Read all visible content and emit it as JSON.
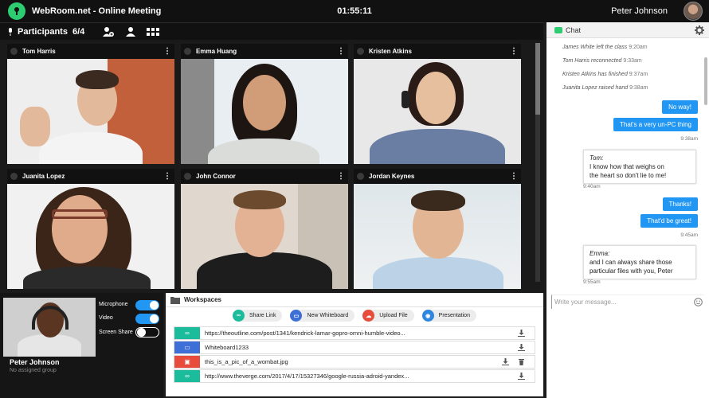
{
  "app": {
    "title": "WebRoom.net  -  Online Meeting",
    "clock": "01:55:11",
    "user": "Peter Johnson"
  },
  "participants": {
    "title": "Participants",
    "count": "6/4"
  },
  "tiles": [
    {
      "name": "Tom Harris"
    },
    {
      "name": "Emma Huang"
    },
    {
      "name": "Kristen Atkins"
    },
    {
      "name": "Juanita Lopez"
    },
    {
      "name": "John Connor"
    },
    {
      "name": "Jordan Keynes"
    }
  ],
  "self": {
    "name": "Peter Johnson",
    "group": "No assigned group",
    "controls": {
      "microphone": "Microphone",
      "video": "Video",
      "screen_share": "Screen Share"
    }
  },
  "workspaces": {
    "title": "Workspaces",
    "actions": [
      "Share Link",
      "New Whiteboard",
      "Upload File",
      "Presentation"
    ],
    "items": [
      "https://theoutline.com/post/1341/kendrick-lamar-gopro-omni-humble-video...",
      "Whiteboard1233",
      "this_is_a_pic_of_a_wombat.jpg",
      "http://www.theverge.com/2017/4/17/15327346/google-russia-adroid-yandex..."
    ]
  },
  "chat": {
    "title": "Chat",
    "system": [
      {
        "text": "James White left the class",
        "time": "9:20am"
      },
      {
        "text": "Tom Harris reconnected",
        "time": "9:33am"
      },
      {
        "text": "Kristen Atkins has finished",
        "time": "9:37am"
      },
      {
        "text": "Juanita Lopez raised hand",
        "time": "9:38am"
      }
    ],
    "out1": [
      "No way!",
      "That's a very un-PC thing"
    ],
    "out1_time": "9:38am",
    "in1": {
      "who": "Tom:",
      "line1": "I know how that weighs on",
      "line2": "the heart so don't lie to me!",
      "time": "9:40am"
    },
    "out2": [
      "Thanks!",
      "That'd be great!"
    ],
    "out2_time": "9:45am",
    "in2": {
      "who": "Emma:",
      "line1": "and I can always share those",
      "line2": "particular files with you, Peter",
      "time": "9:55am"
    },
    "placeholder": "Write your message..."
  }
}
